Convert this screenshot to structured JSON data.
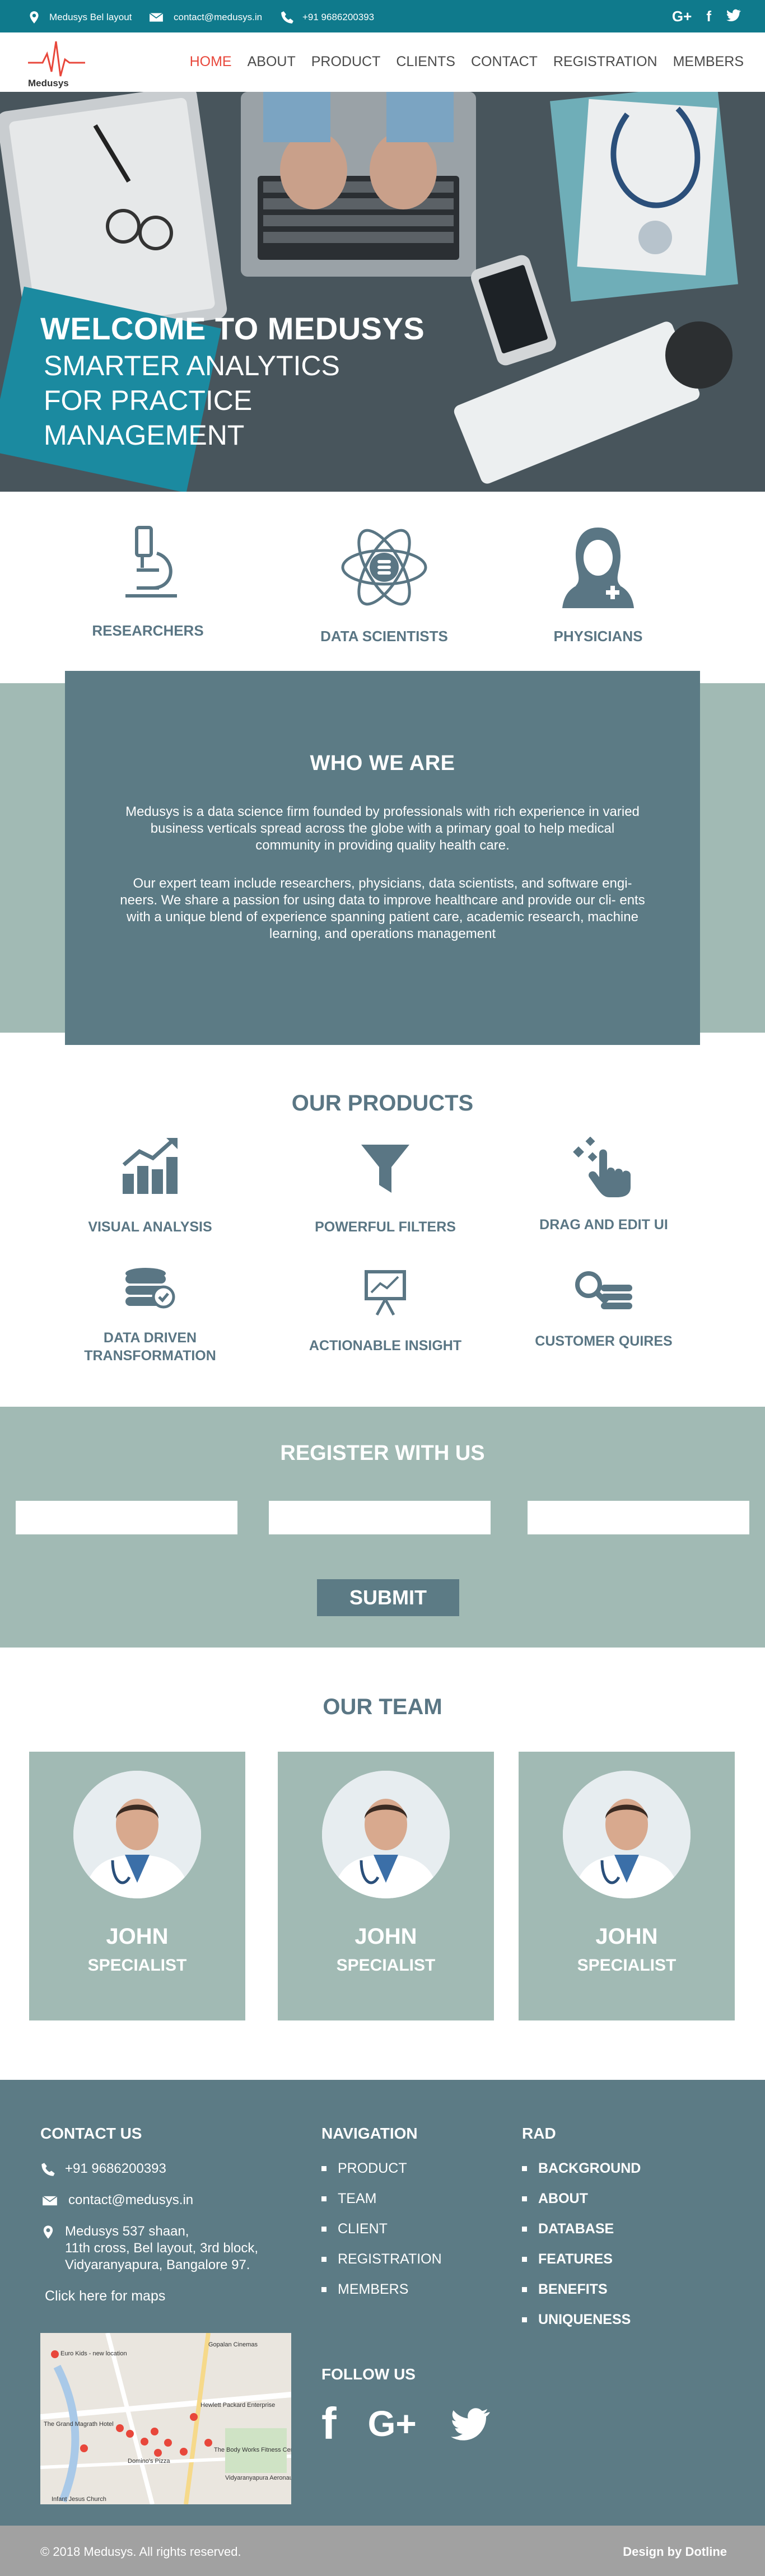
{
  "topbar": {
    "location": "Medusys Bel layout",
    "email": "contact@medusys.in",
    "phone": "+91 9686200393",
    "social": [
      "G+",
      "f",
      "twitter"
    ]
  },
  "brand": {
    "logo_text": "Medusys"
  },
  "nav": {
    "items": [
      "HOME",
      "ABOUT",
      "PRODUCT",
      "CLIENTS",
      "CONTACT",
      "REGISTRATION",
      "MEMBERS"
    ],
    "active": "HOME"
  },
  "hero": {
    "title": "WELCOME TO MEDUSYS",
    "subtitle_lines": [
      "SMARTER ANALYTICS",
      "FOR PRACTICE",
      "MANAGEMENT"
    ]
  },
  "roles": [
    {
      "label": "RESEARCHERS",
      "icon": "microscope-icon"
    },
    {
      "label": "DATA SCIENTISTS",
      "icon": "atom-database-icon"
    },
    {
      "label": "PHYSICIANS",
      "icon": "physician-icon"
    }
  ],
  "who": {
    "title": "WHO WE ARE",
    "p1": "Medusys is a data science firm founded by professionals with rich experience in varied business verticals spread across the globe with a primary goal to help medical community in providing quality health care.",
    "p2": "Our expert team include researchers, physicians, data scientists, and software engi- neers. We share a passion for using data to improve healthcare and provide our cli- ents with a unique blend of experience spanning patient care, academic research, machine learning, and operations management"
  },
  "products": {
    "title": "OUR PRODUCTS",
    "items": [
      {
        "label": "VISUAL ANALYSIS",
        "icon": "bar-growth-icon"
      },
      {
        "label": "POWERFUL FILTERS",
        "icon": "funnel-icon"
      },
      {
        "label": "DRAG AND EDIT UI",
        "icon": "hand-pointer-icon"
      },
      {
        "label": "DATA DRIVEN TRANSFORMATION",
        "icon": "database-check-icon"
      },
      {
        "label": "ACTIONABLE INSIGHT",
        "icon": "presentation-icon"
      },
      {
        "label": "CUSTOMER QUIRES",
        "icon": "search-coins-icon"
      }
    ]
  },
  "register": {
    "title": "REGISTER WITH US",
    "fields": [
      "",
      "",
      ""
    ],
    "submit": "SUBMIT"
  },
  "team": {
    "title": "OUR TEAM",
    "members": [
      {
        "name": "JOHN",
        "role": "SPECIALIST"
      },
      {
        "name": "JOHN",
        "role": "SPECIALIST"
      },
      {
        "name": "JOHN",
        "role": "SPECIALIST"
      }
    ]
  },
  "footer": {
    "contact_title": "CONTACT US",
    "phone": "+91 9686200393",
    "email": "contact@medusys.in",
    "address": [
      "Medusys 537 shaan,",
      "11th cross, Bel layout, 3rd block,",
      "Vidyaranyapura, Bangalore 97."
    ],
    "map_link": "Click here for maps",
    "map_labels": [
      "Euro Kids - new location",
      "Gopalan Cinemas",
      "The Grand Magrath Hotel",
      "Hewlett Packard Enterprise",
      "The Body Works Fitness Center",
      "Domino's Pizza",
      "Infant Jesus Church",
      "Vidyaranyapura Aeronautics Limited"
    ],
    "nav_title": "NAVIGATION",
    "nav_items": [
      "PRODUCT",
      "TEAM",
      "CLIENT",
      "REGISTRATION",
      "MEMBERS"
    ],
    "rad_title": "RAD",
    "rad_items": [
      "BACKGROUND",
      "ABOUT",
      "DATABASE",
      "FEATURES",
      "BENEFITS",
      "UNIQUENESS"
    ],
    "follow_title": "FOLLOW US",
    "follow": [
      "f",
      "G+",
      "twitter"
    ]
  },
  "copyright": "© 2018 Medusys. All rights reserved.",
  "credit": "Design by Dotline",
  "colors": {
    "teal": "#0f7a8c",
    "slate": "#5c7b85",
    "sage": "#a1bab4",
    "accent": "#e8473b",
    "grey": "#a1a1a1"
  }
}
